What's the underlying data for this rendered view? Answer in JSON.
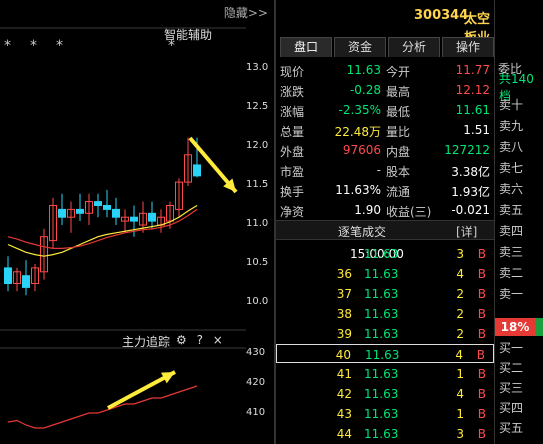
{
  "toolbar": {
    "hide_label": "隐藏>>"
  },
  "chart": {
    "smart_label": "智能辅助",
    "stars": [
      "*",
      "*",
      "*",
      "*"
    ],
    "price_ticks": [
      "13.0",
      "12.5",
      "12.0",
      "11.5",
      "11.0",
      "10.5",
      "10.0"
    ],
    "volume_ticks": [
      "430",
      "420",
      "410"
    ],
    "indicator_label": "主力追踪",
    "tool_icons": [
      "gear-icon",
      "help-icon",
      "close-icon"
    ],
    "tool_glyphs": {
      "gear": "⚙",
      "help": "?",
      "close": "×"
    }
  },
  "chart_data": {
    "type": "candlestick",
    "y_axis": [
      10.0,
      13.0
    ],
    "candles": [
      {
        "o": 10.45,
        "h": 10.6,
        "l": 10.15,
        "c": 10.25
      },
      {
        "o": 10.25,
        "h": 10.45,
        "l": 10.15,
        "c": 10.4
      },
      {
        "o": 10.35,
        "h": 10.55,
        "l": 10.1,
        "c": 10.2
      },
      {
        "o": 10.25,
        "h": 10.5,
        "l": 10.15,
        "c": 10.45
      },
      {
        "o": 10.4,
        "h": 10.95,
        "l": 10.3,
        "c": 10.85
      },
      {
        "o": 10.8,
        "h": 11.35,
        "l": 10.7,
        "c": 11.25
      },
      {
        "o": 11.2,
        "h": 11.4,
        "l": 11.0,
        "c": 11.1
      },
      {
        "o": 11.1,
        "h": 11.3,
        "l": 10.9,
        "c": 11.2
      },
      {
        "o": 11.2,
        "h": 11.4,
        "l": 11.05,
        "c": 11.15
      },
      {
        "o": 11.15,
        "h": 11.4,
        "l": 11.0,
        "c": 11.3
      },
      {
        "o": 11.3,
        "h": 11.4,
        "l": 11.1,
        "c": 11.25
      },
      {
        "o": 11.25,
        "h": 11.45,
        "l": 11.1,
        "c": 11.2
      },
      {
        "o": 11.2,
        "h": 11.35,
        "l": 11.0,
        "c": 11.1
      },
      {
        "o": 11.05,
        "h": 11.2,
        "l": 10.9,
        "c": 11.1
      },
      {
        "o": 11.1,
        "h": 11.25,
        "l": 10.85,
        "c": 11.05
      },
      {
        "o": 11.0,
        "h": 11.3,
        "l": 10.9,
        "c": 11.15
      },
      {
        "o": 11.15,
        "h": 11.3,
        "l": 10.95,
        "c": 11.05
      },
      {
        "o": 11.0,
        "h": 11.2,
        "l": 10.9,
        "c": 11.1
      },
      {
        "o": 11.05,
        "h": 11.3,
        "l": 10.95,
        "c": 11.25
      },
      {
        "o": 11.2,
        "h": 11.6,
        "l": 11.1,
        "c": 11.55
      },
      {
        "o": 11.55,
        "h": 12.12,
        "l": 11.5,
        "c": 11.9
      },
      {
        "o": 11.77,
        "h": 12.12,
        "l": 11.61,
        "c": 11.63
      }
    ],
    "ma_yellow": [
      10.75,
      10.7,
      10.65,
      10.62,
      10.6,
      10.62,
      10.65,
      10.7,
      10.75,
      10.8,
      10.85,
      10.88,
      10.9,
      10.92,
      10.94,
      10.96,
      10.98,
      11.0,
      11.04,
      11.1,
      11.18,
      11.25
    ],
    "ma_red": [
      10.85,
      10.82,
      10.78,
      10.75,
      10.72,
      10.7,
      10.7,
      10.71,
      10.73,
      10.76,
      10.8,
      10.84,
      10.87,
      10.9,
      10.92,
      10.94,
      10.95,
      10.97,
      11.0,
      11.05,
      11.12,
      11.2
    ],
    "volume_line": [
      411,
      411.5,
      410,
      409,
      409,
      410,
      411,
      412,
      413,
      414,
      414,
      415,
      416,
      417,
      417,
      418,
      419,
      419,
      420,
      421,
      422,
      423
    ],
    "volume_y": [
      405,
      435
    ]
  },
  "panel": {
    "code": "300344",
    "name": "太空板业",
    "tabs": [
      "盘口",
      "资金",
      "分析",
      "操作"
    ],
    "quotes": [
      {
        "l1": "现价",
        "v1": "11.63",
        "l2": "今开",
        "v2": "11.77"
      },
      {
        "l1": "涨跌",
        "v1": "-0.28",
        "l2": "最高",
        "v2": "12.12"
      },
      {
        "l1": "涨幅",
        "v1": "-2.35%",
        "l2": "最低",
        "v2": "11.61"
      },
      {
        "l1": "总量",
        "v1": "22.48万",
        "l2": "量比",
        "v2": "1.51"
      },
      {
        "l1": "外盘",
        "v1": "97606",
        "l2": "内盘",
        "v2": "127212"
      },
      {
        "l1": "市盈",
        "v1": "-",
        "l2": "股本",
        "v2": "3.38亿"
      },
      {
        "l1": "换手",
        "v1": "11.63%",
        "l2": "流通",
        "v2": "1.93亿"
      },
      {
        "l1": "净资",
        "v1": "1.90",
        "l2": "收益(三)",
        "v2": "-0.021"
      }
    ],
    "trade_header": "逐笔成交",
    "detail_label": "[详]",
    "trades": [
      {
        "time": "15:00:00",
        "price": "11.63",
        "vol": "3",
        "bs": "B"
      },
      {
        "time": "36",
        "price": "11.63",
        "vol": "4",
        "bs": "B"
      },
      {
        "time": "37",
        "price": "11.63",
        "vol": "2",
        "bs": "B"
      },
      {
        "time": "38",
        "price": "11.63",
        "vol": "2",
        "bs": "B"
      },
      {
        "time": "39",
        "price": "11.63",
        "vol": "2",
        "bs": "B"
      },
      {
        "time": "40",
        "price": "11.63",
        "vol": "4",
        "bs": "B"
      },
      {
        "time": "41",
        "price": "11.63",
        "vol": "1",
        "bs": "B"
      },
      {
        "time": "42",
        "price": "11.63",
        "vol": "4",
        "bs": "B"
      },
      {
        "time": "43",
        "price": "11.63",
        "vol": "1",
        "bs": "B"
      },
      {
        "time": "44",
        "price": "11.63",
        "vol": "3",
        "bs": "B"
      }
    ]
  },
  "orderbook": {
    "title": "委比",
    "total": "共140档",
    "sell": [
      "卖十",
      "卖九",
      "卖八",
      "卖七",
      "卖六",
      "卖五",
      "卖四",
      "卖三",
      "卖二",
      "卖一"
    ],
    "ratio": "18%",
    "ratio_fraction": 0.18,
    "buy": [
      "买一",
      "买二",
      "买三",
      "买四",
      "买五"
    ]
  },
  "colors": {
    "up": "#ff4a4a",
    "down": "#00e676",
    "arrow": "#ffeb3b"
  }
}
